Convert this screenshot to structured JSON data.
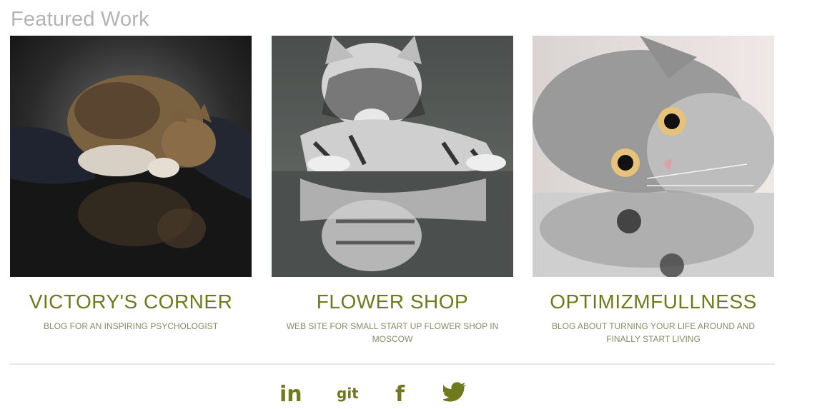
{
  "section": {
    "title": "Featured Work"
  },
  "projects": [
    {
      "title": "VICTORY'S CORNER",
      "description": "BLOG FOR AN INSPIRING PSYCHOLOGIST"
    },
    {
      "title": "FLOWER SHOP",
      "description": "WEB SITE FOR SMALL START UP FLOWER SHOP IN MOSCOW"
    },
    {
      "title": "OPTIMIZMFULLNESS",
      "description": "BLOG ABOUT TURNING YOUR LIFE AROUND AND FINALLY START LIVING"
    }
  ],
  "social": [
    {
      "icon": "linkedin-icon",
      "text": "in"
    },
    {
      "icon": "github-icon",
      "text": "git"
    },
    {
      "icon": "facebook-icon",
      "text": "f"
    },
    {
      "icon": "twitter-icon"
    }
  ],
  "colors": {
    "accent": "#6f7a1e",
    "title_gray": "#b3b3b3",
    "divider": "#e6e6e6"
  }
}
